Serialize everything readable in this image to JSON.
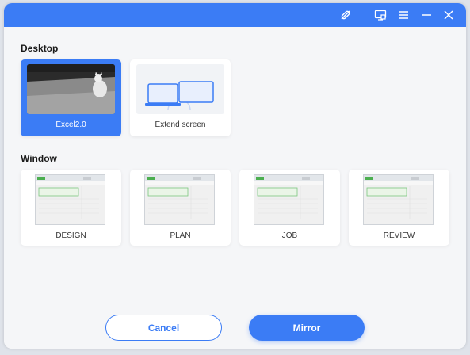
{
  "titlebar": {
    "icons": [
      "disconnect-icon",
      "cast-screen-icon",
      "menu-icon",
      "minimize-icon",
      "close-icon"
    ]
  },
  "desktop": {
    "title": "Desktop",
    "items": [
      {
        "label": "Excel2.0",
        "selected": true
      },
      {
        "label": "Extend screen",
        "selected": false
      }
    ]
  },
  "window": {
    "title": "Window",
    "items": [
      {
        "label": "DESIGN"
      },
      {
        "label": "PLAN"
      },
      {
        "label": "JOB"
      },
      {
        "label": "REVIEW"
      }
    ]
  },
  "actions": {
    "cancel_label": "Cancel",
    "mirror_label": "Mirror"
  },
  "colors": {
    "accent": "#3b7cf5",
    "background": "#f5f6f8"
  }
}
